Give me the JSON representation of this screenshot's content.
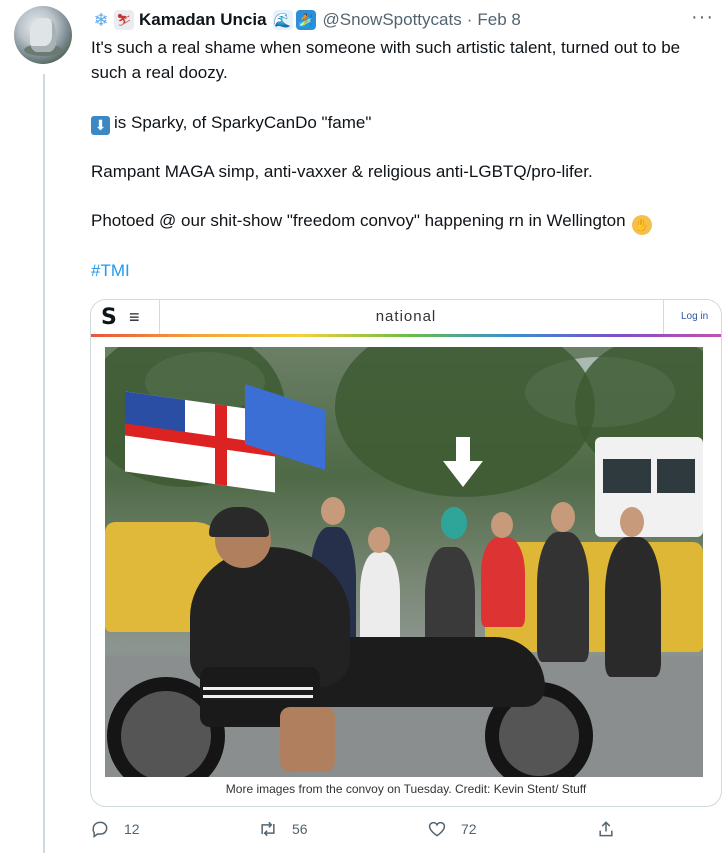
{
  "tweet": {
    "display_name": "Kamadan Uncia",
    "handle": "@SnowSpottycats",
    "separator": "·",
    "date": "Feb 8",
    "more_label": "···",
    "paragraph1": "It's such a real shame when someone with such artistic talent, turned out to be such a real doozy.",
    "paragraph2": "is Sparky, of SparkyCanDo \"fame\"",
    "paragraph3": "Rampant MAGA simp, anti-vaxxer & religious anti-LGBTQ/pro-lifer.",
    "paragraph4": "Photoed @ our shit-show \"freedom convoy\" happening rn in Wellington",
    "hashtag": "#TMI",
    "name_emojis": [
      "snowflake-icon",
      "skier-icon"
    ],
    "post_name_emojis": [
      "wave-icon",
      "surfer-icon"
    ],
    "down_arrow_emoji": "⬇",
    "facepalm_emoji": "facepalm-icon"
  },
  "media": {
    "site_logo": "S",
    "site_menu": "≡",
    "site_name": "national",
    "login_label": "Log in",
    "caption": "More images from the convoy on Tuesday. Credit: Kevin Stent/ Stuff"
  },
  "actions": {
    "replies": "12",
    "retweets": "56",
    "likes": "72"
  },
  "colors": {
    "link": "#1d9bf0",
    "muted": "#536471",
    "border": "#cfd9de"
  }
}
